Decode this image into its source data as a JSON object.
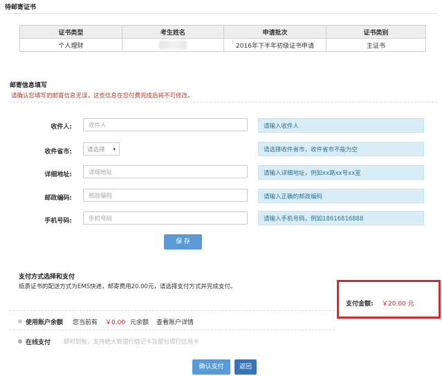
{
  "pending": {
    "title": "待邮寄证书",
    "columns": [
      "证书类型",
      "考生姓名",
      "申请批次",
      "证书类别"
    ],
    "row": {
      "type": "个人理财",
      "name": "",
      "batch": "2016年下半年初级证书申请",
      "category": "主证书"
    }
  },
  "mail": {
    "title": "邮寄信息填写",
    "warning": "请确认您填写的邮寄信息无误，这些信息在您付费完成后将不可修改。",
    "fields": [
      {
        "label": "收件人:",
        "placeholder": "收件人",
        "tip": "请输入收件人"
      },
      {
        "label": "收件省市:",
        "placeholder": "请选择",
        "tip": "请选择收件省市，收件省市不能为空"
      },
      {
        "label": "详细地址:",
        "placeholder": "详细地址",
        "tip": "请输入详细地址，例如xx路xx号xx室"
      },
      {
        "label": "邮政编码:",
        "placeholder": "邮政编码",
        "tip": "请输入正确的邮政编码"
      },
      {
        "label": "手机号码:",
        "placeholder": "手机号码",
        "tip": "请输入手机号码，例如18616816888"
      }
    ],
    "save_label": "保 存"
  },
  "payment": {
    "title": "支付方式选择和支付",
    "desc": "纸质证书的配送方式为EMS快递，邮寄费用20.00元，请选择支付方式并完成支付。",
    "amount_label": "支付金额:",
    "amount_value": "￥20.00 元",
    "balance_label": "使用账户余额",
    "balance_prefix": "您当前有",
    "balance_value": "￥0.00",
    "balance_suffix": "元余额",
    "balance_link": "查看账户详情",
    "online_label": "在线支付",
    "online_desc": "即时到账，支持绝大数银行借记卡及部分银行信用卡",
    "confirm_label": "确认支付",
    "back_label": "返回"
  },
  "colors": {
    "accent": "#5b9bd5",
    "warning": "#c0392b",
    "highlight_border": "#d9262b",
    "tip_bg": "#d9edf7"
  }
}
